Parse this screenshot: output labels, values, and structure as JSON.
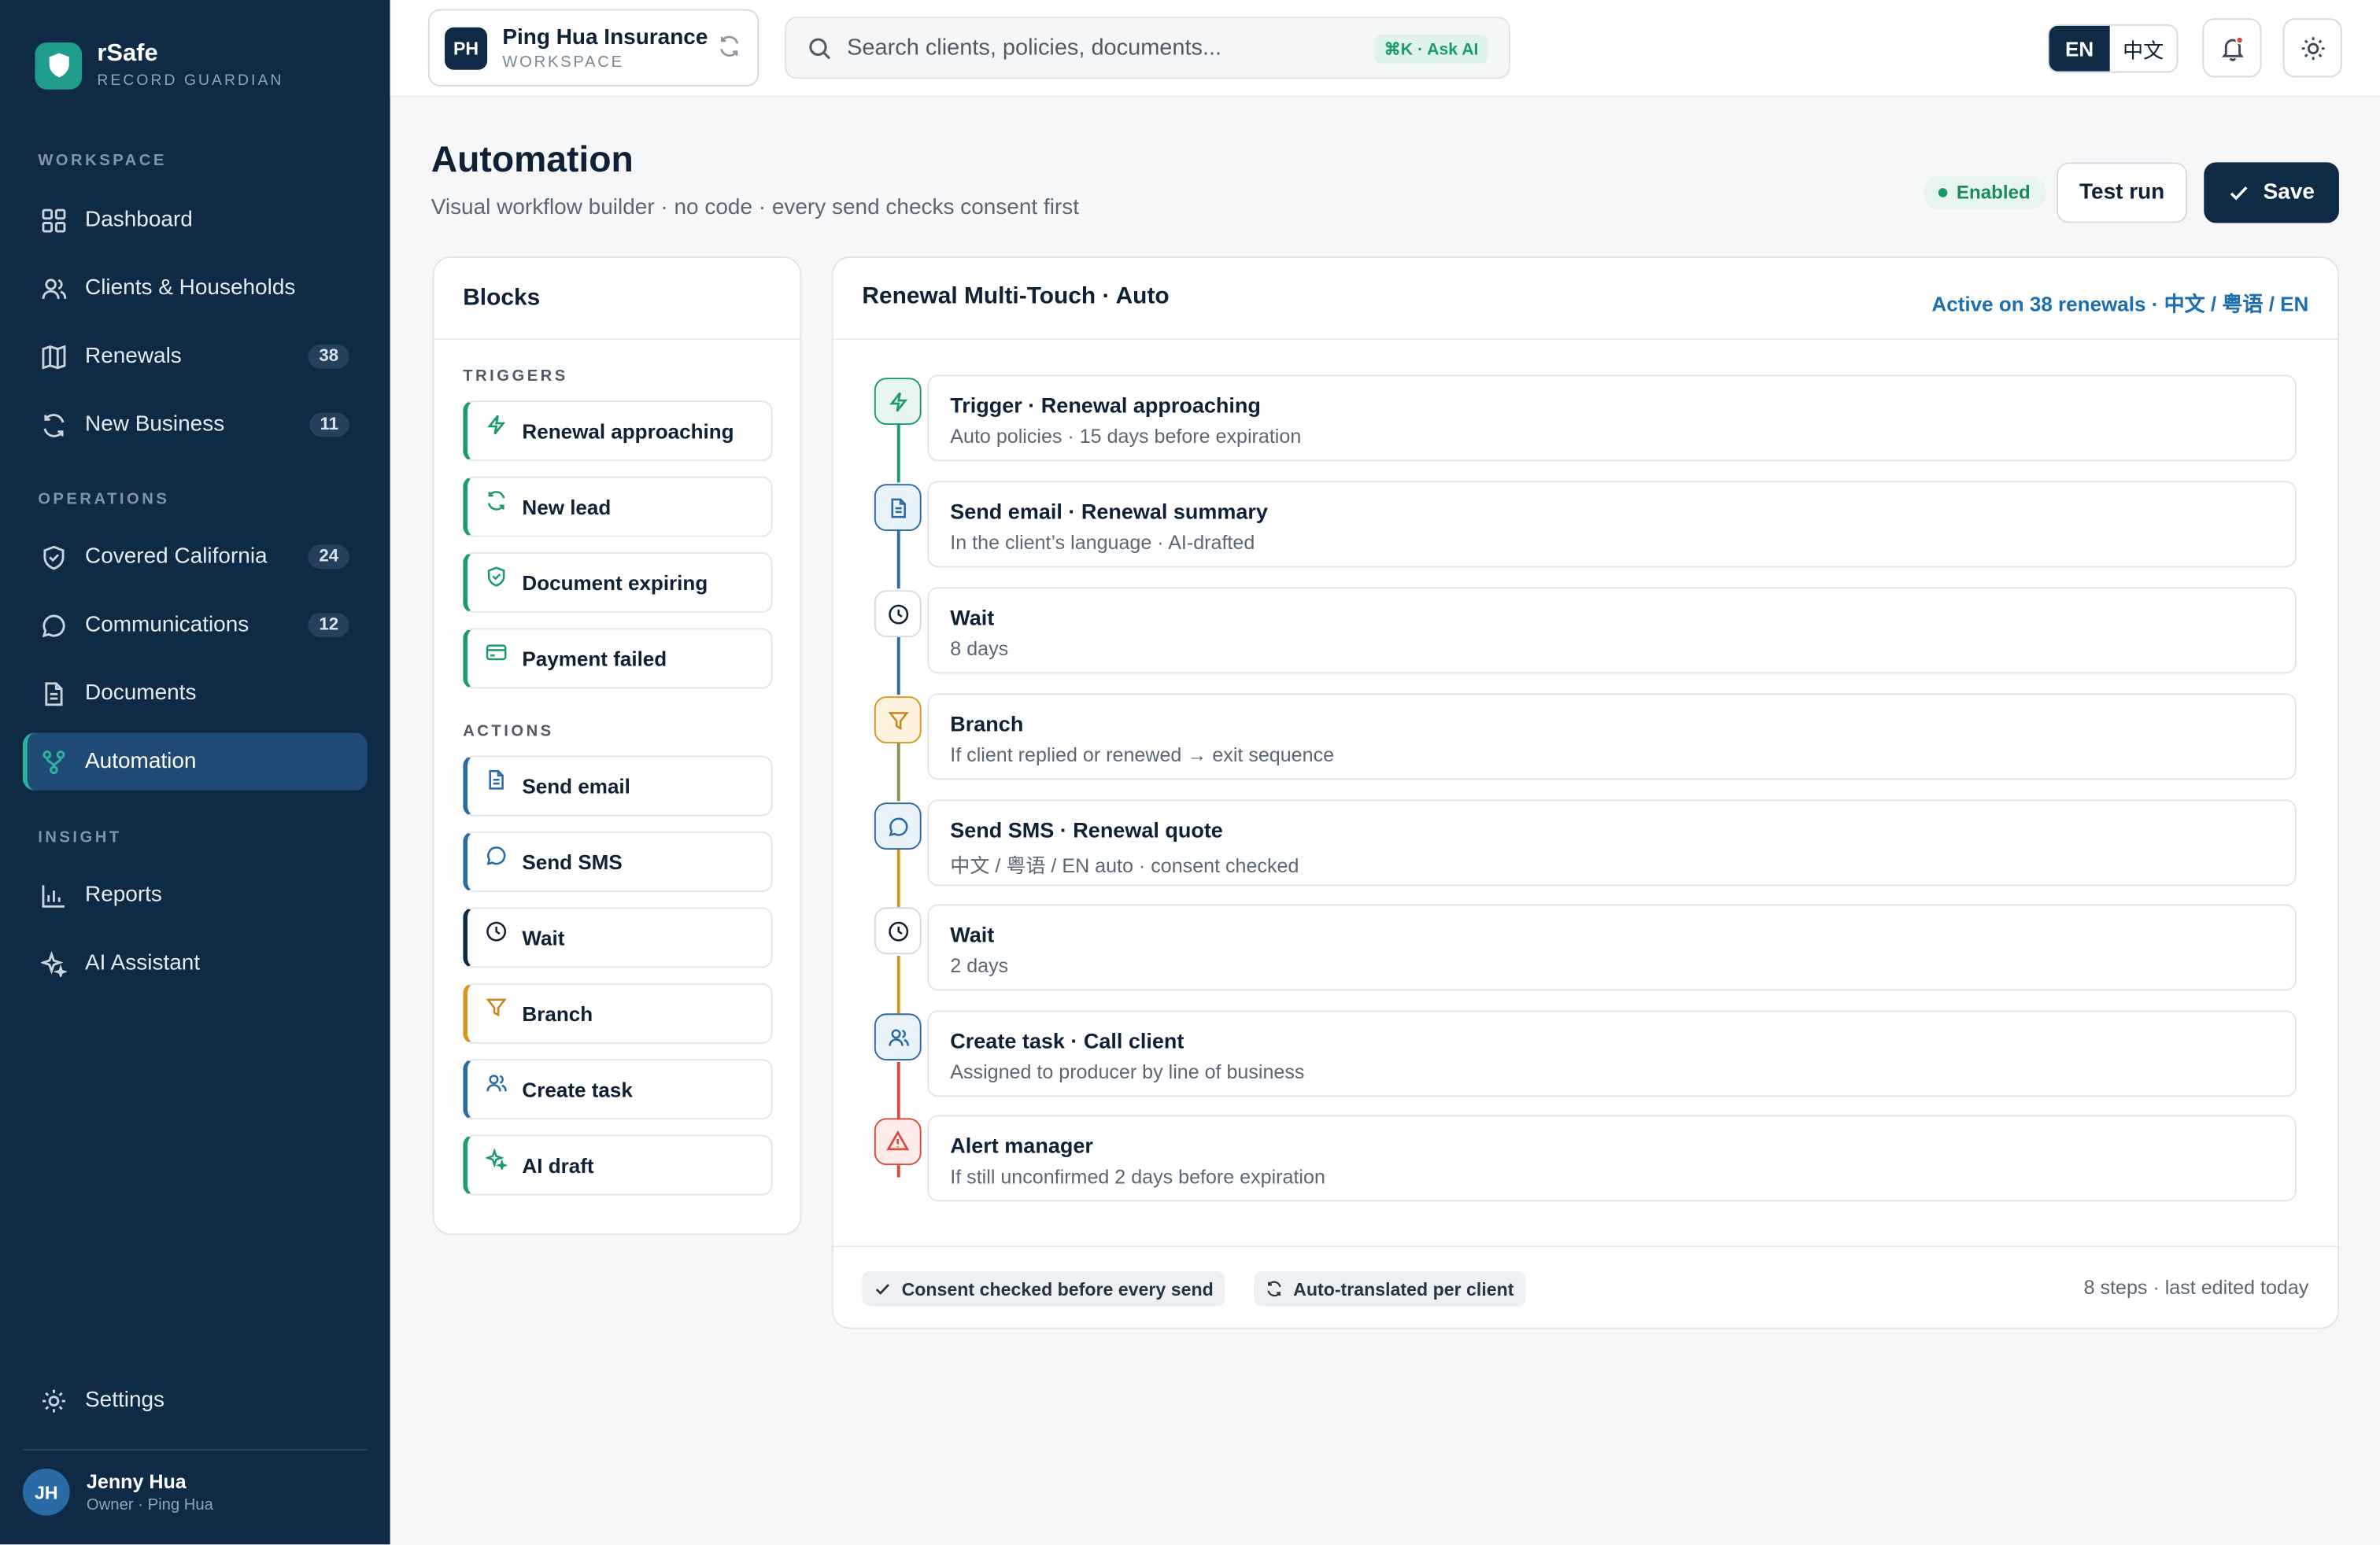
{
  "brand": {
    "name": "rSafe",
    "tagline": "RECORD GUARDIAN"
  },
  "sidebar": {
    "sections": [
      {
        "label": "WORKSPACE"
      },
      {
        "label": "OPERATIONS"
      },
      {
        "label": "INSIGHT"
      }
    ],
    "items": [
      {
        "label": "Dashboard",
        "icon": "grid-icon"
      },
      {
        "label": "Clients & Households",
        "icon": "users-icon"
      },
      {
        "label": "Renewals",
        "icon": "map-icon",
        "badge": "38"
      },
      {
        "label": "New Business",
        "icon": "refresh-icon",
        "badge": "11"
      },
      {
        "label": "Covered California",
        "icon": "shield-icon",
        "badge": "24"
      },
      {
        "label": "Communications",
        "icon": "chat-icon",
        "badge": "12"
      },
      {
        "label": "Documents",
        "icon": "document-icon"
      },
      {
        "label": "Automation",
        "icon": "workflow-icon",
        "active": true
      },
      {
        "label": "Reports",
        "icon": "bar-chart-icon"
      },
      {
        "label": "AI Assistant",
        "icon": "sparkle-icon"
      }
    ],
    "settings_label": "Settings",
    "user": {
      "initials": "JH",
      "name": "Jenny Hua",
      "role": "Owner · Ping Hua"
    }
  },
  "topbar": {
    "workspace": {
      "initials": "PH",
      "name": "Ping Hua Insurance",
      "sub": "WORKSPACE"
    },
    "search": {
      "placeholder": "Search clients, policies, documents...",
      "shortcut": "⌘K · Ask AI"
    },
    "languages": [
      "EN",
      "中文"
    ],
    "active_language": "EN"
  },
  "page": {
    "title": "Automation",
    "subtitle": "Visual workflow builder · no code · every send checks consent first",
    "status": "Enabled",
    "test_run_label": "Test run",
    "save_label": "Save"
  },
  "blocks": {
    "title": "Blocks",
    "triggers_label": "TRIGGERS",
    "triggers": [
      {
        "label": "Renewal approaching",
        "icon": "bolt-icon"
      },
      {
        "label": "New lead",
        "icon": "refresh-icon"
      },
      {
        "label": "Document expiring",
        "icon": "shield-check-icon"
      },
      {
        "label": "Payment failed",
        "icon": "card-icon"
      }
    ],
    "actions_label": "ACTIONS",
    "actions": [
      {
        "label": "Send email",
        "icon": "document-icon"
      },
      {
        "label": "Send SMS",
        "icon": "chat-icon"
      },
      {
        "label": "Wait",
        "icon": "clock-icon"
      },
      {
        "label": "Branch",
        "icon": "filter-icon"
      },
      {
        "label": "Create task",
        "icon": "users-icon"
      },
      {
        "label": "AI draft",
        "icon": "sparkle-icon"
      }
    ]
  },
  "flow": {
    "title": "Renewal Multi-Touch · Auto",
    "active_text": "Active on 38 renewals · 中文 / 粤语 / EN",
    "steps": [
      {
        "title": "Trigger · Renewal approaching",
        "sub": "Auto policies · 15 days before expiration",
        "icon": "bolt-icon"
      },
      {
        "title": "Send email · Renewal summary",
        "sub": "In the client’s language · AI-drafted",
        "icon": "document-icon"
      },
      {
        "title": "Wait",
        "sub": "8 days",
        "icon": "clock-icon"
      },
      {
        "title": "Branch",
        "sub": "If client replied or renewed → exit sequence",
        "icon": "filter-icon"
      },
      {
        "title": "Send SMS · Renewal quote",
        "sub": "中文 / 粤语 / EN auto · consent checked",
        "icon": "chat-icon"
      },
      {
        "title": "Wait",
        "sub": "2 days",
        "icon": "clock-icon"
      },
      {
        "title": "Create task · Call client",
        "sub": "Assigned to producer by line of business",
        "icon": "users-icon"
      },
      {
        "title": "Alert manager",
        "sub": "If still unconfirmed 2 days before expiration",
        "icon": "alert-triangle-icon"
      }
    ],
    "footer": {
      "chips": [
        "Consent checked before every send",
        "Auto-translated per client"
      ],
      "meta": "8 steps · last edited today"
    }
  },
  "colors": {
    "sidebar": "#0f2a44",
    "accent": "#1f9c8e",
    "green": "#1b9a6c",
    "blue": "#1d6fb0",
    "amber": "#d9961f",
    "red": "#d84b3e"
  }
}
